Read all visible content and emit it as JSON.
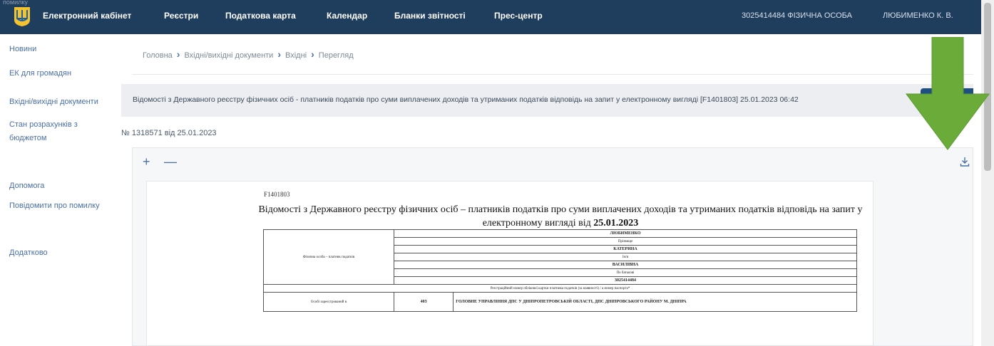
{
  "header": {
    "stray_text": "помилку",
    "cabinet_title": "Електронний кабінет",
    "nav": [
      "Реєстри",
      "Податкова карта",
      "Календар",
      "Бланки звітності",
      "Прес-центр"
    ],
    "user_code": "3025414484 ФІЗИЧНА ОСОБА",
    "user_name": "ЛЮБИМЕНКО К. В."
  },
  "sidebar": {
    "items": [
      {
        "label": "Новини"
      },
      {
        "label": "ЕК для громадян"
      },
      {
        "label": "Вхідні/вихідні документи"
      },
      {
        "label": "Стан розрахунків з бюджетом"
      },
      {
        "label": "Допомога"
      },
      {
        "label": "Повідомити про помилку"
      },
      {
        "label": "Додатково"
      }
    ]
  },
  "breadcrumb": [
    "Головна",
    "Вхідні/вихідні документи",
    "Вхідні",
    "Перегляд"
  ],
  "document": {
    "title": "Відомості з Державного реєстру фізичних осіб - платників податків про суми виплачених доходів та утриманих податків відповідь на запит у електронному вигляді [F1401803] 25.01.2023 06:42",
    "number": "№ 1318571 від 25.01.2023",
    "button_label": "D"
  },
  "viewer": {
    "zoom_in": "+",
    "zoom_out": "—",
    "download_icon": "download-icon"
  },
  "form": {
    "code": "F1401803",
    "title_line1": "Відомості з Державного реєстру фізичних осіб – платників податків про суми виплачених доходів та утриманих податків відповідь на запит у",
    "title_line2_prefix": "електронному вигляді від ",
    "title_date": "25.01.2023",
    "person_label": "Фізична особа – платник податків",
    "person_rows": [
      "ЛЮБИМЕНКО",
      "Прізвище",
      "КАТЕРИНА",
      "Ім'я",
      "ВАСИЛІВНА",
      "По батькові",
      "3025414484"
    ],
    "rnokpp_note": "Реєстраційний номер облікової картки платника податків (за наявності) / а номер паспорта*",
    "org_label": "Особі зареєстрований в",
    "org_code": "403",
    "org_name": "ГОЛОВНЕ УПРАВЛІННЯ ДПС У ДНІПРОПЕТРОВСЬКІЙ ОБЛАСТІ, ДПС ДНІПРОВСЬКОГО РАЙОНУ М. ДНІПРА"
  },
  "colors": {
    "topbar": "#1f3d5c",
    "accent": "#1f4f82",
    "arrow": "#6aab3a"
  }
}
